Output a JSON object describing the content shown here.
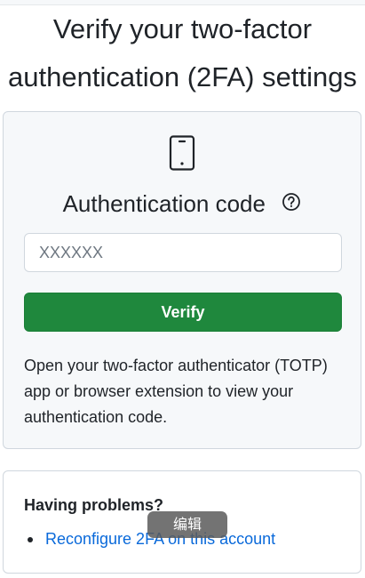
{
  "page": {
    "title_line1": "Verify your two-factor",
    "title_line2": "authentication (2FA) settings"
  },
  "auth_card": {
    "icon": "device-mobile-icon",
    "heading": "Authentication code",
    "help_icon": "question-circle-icon",
    "code_input": {
      "value": "",
      "placeholder": "XXXXXX"
    },
    "verify_label": "Verify",
    "instructions": "Open your two-factor authenticator (TOTP) app or browser extension to view your authentication code."
  },
  "problems_card": {
    "heading": "Having problems?",
    "links": [
      {
        "label": "Reconfigure 2FA on this account"
      }
    ]
  },
  "overlay": {
    "chip_label": "编辑"
  },
  "colors": {
    "primary_button": "#1f883d",
    "link": "#0969da",
    "card_bg": "#f6f8fa",
    "border": "#d0d7de"
  }
}
